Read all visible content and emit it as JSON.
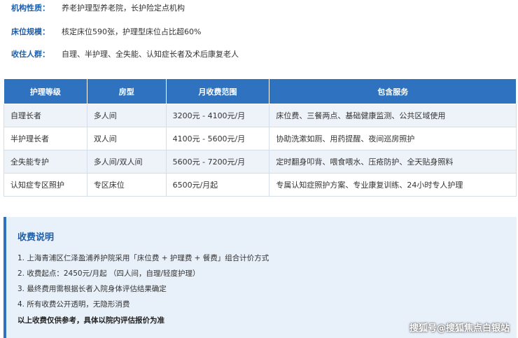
{
  "info": [
    {
      "label": "机构性质：",
      "value": "养老护理型养老院，长护险定点机构"
    },
    {
      "label": "床位规模：",
      "value": "核定床位590张，护理型床位占比超60%"
    },
    {
      "label": "收住人群：",
      "value": "自理、半护理、全失能、认知症长者及术后康复老人"
    }
  ],
  "table": {
    "headers": [
      "护理等级",
      "房型",
      "月收费范围",
      "包含服务"
    ],
    "rows": [
      [
        "自理长者",
        "多人间",
        "3200元 - 4100元/月",
        "床位费、三餐两点、基础健康监测、公共区域使用"
      ],
      [
        "半护理长者",
        "双人间",
        "4100元 - 5600元/月",
        "协助洗漱如厕、用药提醒、夜间巡房照护"
      ],
      [
        "全失能专护",
        "多人间/双人间",
        "5600元 - 7200元/月",
        "定时翻身叩背、喂食喂水、压疮防护、全天贴身照料"
      ],
      [
        "认知症专区照护",
        "专区床位",
        "6500元/月起",
        "专属认知症照护方案、专业康复训练、24小时专人护理"
      ]
    ]
  },
  "notes": {
    "title": "收费说明",
    "items": [
      "1. 上海青浦区仁泽盈浦养护院采用「床位费 + 护理费 + 餐费」组合计价方式",
      "2. 收费起点：2450元/月起 （四人间，自理/轻度护理）",
      "3. 最终费用需根据长者入院身体评估结果确定",
      "4. 所有收费公开透明，无隐形消费"
    ],
    "footer": "以上收费仅供参考，具体以院内评估报价为准"
  },
  "watermark": "搜狐号@搜狐焦点白银站",
  "colors": {
    "accent": "#2f72c0",
    "label": "#1f5fa8",
    "panel_bg": "#e8f0fa",
    "row_alt": "#eef3fa"
  }
}
